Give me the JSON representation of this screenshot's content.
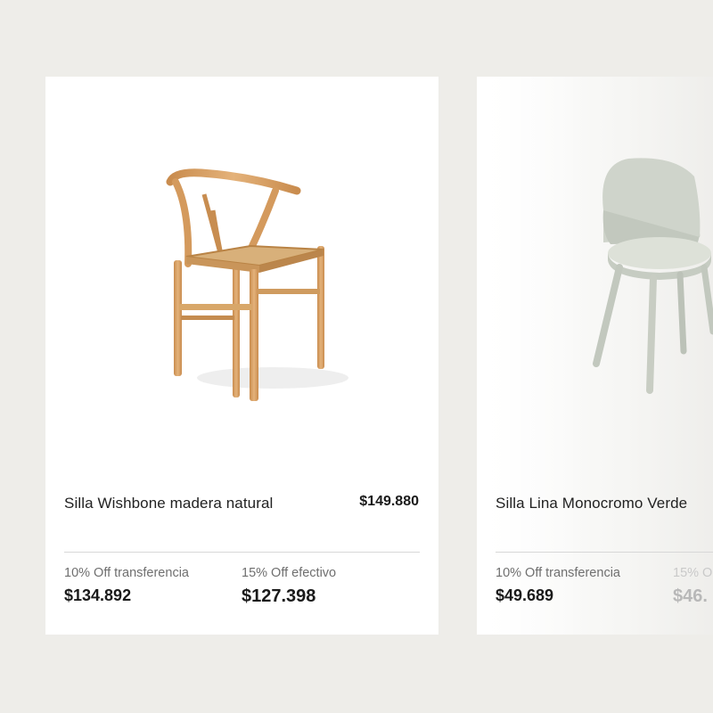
{
  "products": [
    {
      "name": "Silla Wishbone madera natural",
      "price": "$149.880",
      "image_icon": "wishbone-chair-icon",
      "offers": [
        {
          "label": "10% Off transferencia",
          "price": "$134.892"
        },
        {
          "label": "15% Off efectivo",
          "price": "$127.398"
        }
      ]
    },
    {
      "name": "Silla Lina Monocromo Verde",
      "image_icon": "lina-chair-icon",
      "offers": [
        {
          "label": "10% Off transferencia",
          "price": "$49.689"
        },
        {
          "label": "15% O",
          "price": "$46."
        }
      ]
    }
  ],
  "colors": {
    "background": "#eeede9",
    "card": "#ffffff",
    "wood": "#d9a466",
    "sage": "#c9cec4"
  }
}
